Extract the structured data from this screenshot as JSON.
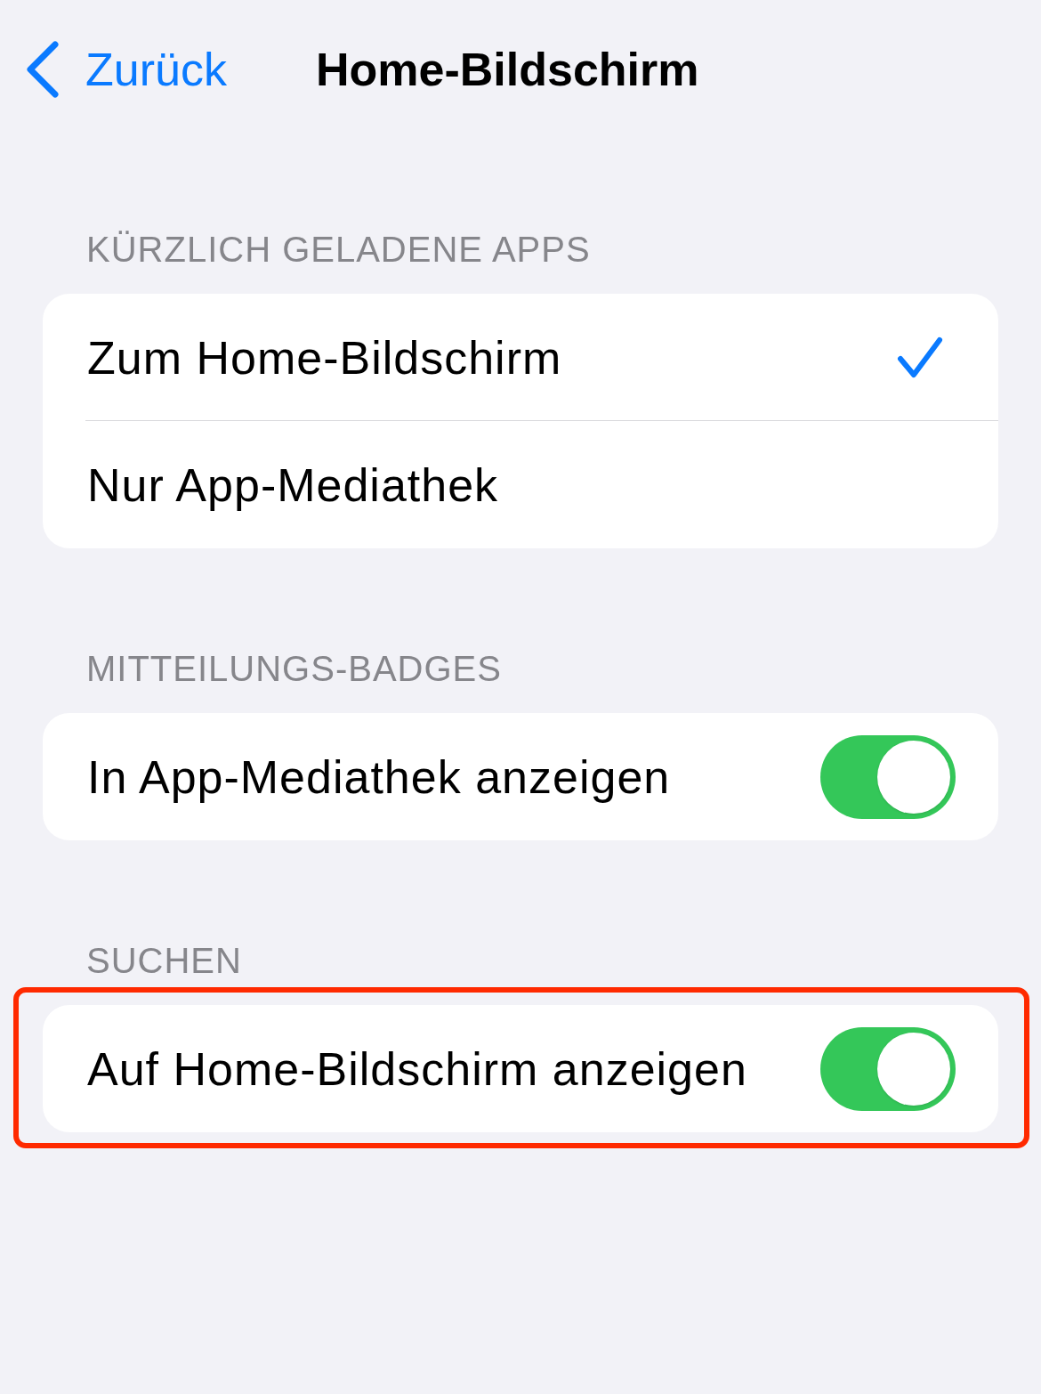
{
  "nav": {
    "back": "Zurück",
    "title": "Home-Bildschirm"
  },
  "sections": [
    {
      "header": "KÜRZLICH GELADENE APPS",
      "highlighted": false,
      "rows": [
        {
          "kind": "choice",
          "label": "Zum Home-Bildschirm",
          "selected": true
        },
        {
          "kind": "choice",
          "label": "Nur App-Mediathek",
          "selected": false
        }
      ]
    },
    {
      "header": "MITTEILUNGS-BADGES",
      "highlighted": false,
      "rows": [
        {
          "kind": "toggle",
          "label": "In App-Mediathek anzeigen",
          "on": true
        }
      ]
    },
    {
      "header": "SUCHEN",
      "highlighted": true,
      "rows": [
        {
          "kind": "toggle",
          "label": "Auf Home-Bildschirm anzeigen",
          "on": true
        }
      ]
    }
  ]
}
